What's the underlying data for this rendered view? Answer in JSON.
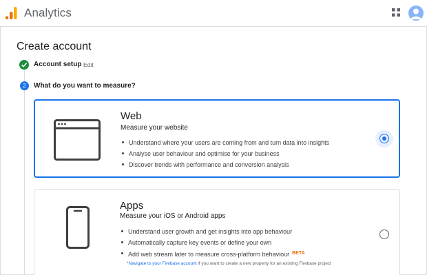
{
  "app": {
    "title": "Analytics"
  },
  "header": {
    "apps_icon": "apps-grid-icon",
    "avatar_icon": "account-avatar-icon",
    "colors": {
      "logo_orange": "#f9ab00",
      "logo_dark_orange": "#e37400",
      "avatar": "#8ab4f8"
    }
  },
  "page": {
    "title": "Create account"
  },
  "steps": [
    {
      "number": "1",
      "label": "Account setup",
      "status": "complete",
      "action": "Edit"
    },
    {
      "number": "2",
      "label": "What do you want to measure?",
      "status": "active"
    }
  ],
  "options": [
    {
      "title": "Web",
      "subtitle": "Measure your website",
      "bullets": [
        "Understand where your users are coming from and turn data into insights",
        "Analyse user behaviour and optimise for your business",
        "Discover trends with performance and conversion analysis"
      ],
      "selected": true,
      "icon": "browser-window-icon"
    },
    {
      "title": "Apps",
      "subtitle": "Measure your iOS or Android apps",
      "bullets": [
        "Understand user growth and get insights into app behaviour",
        "Automatically capture key events or define your own",
        "Add web stream later to measure cross-platform behaviour"
      ],
      "badge": "BETA",
      "note_link": "*Navigate to your Firebase account",
      "note_text": " if you want to create a new property for an existing Firebase project",
      "selected": false,
      "icon": "mobile-phone-icon"
    }
  ],
  "colors": {
    "accent": "#1a73e8",
    "success": "#1e8e3e",
    "beta": "#e8710a"
  }
}
